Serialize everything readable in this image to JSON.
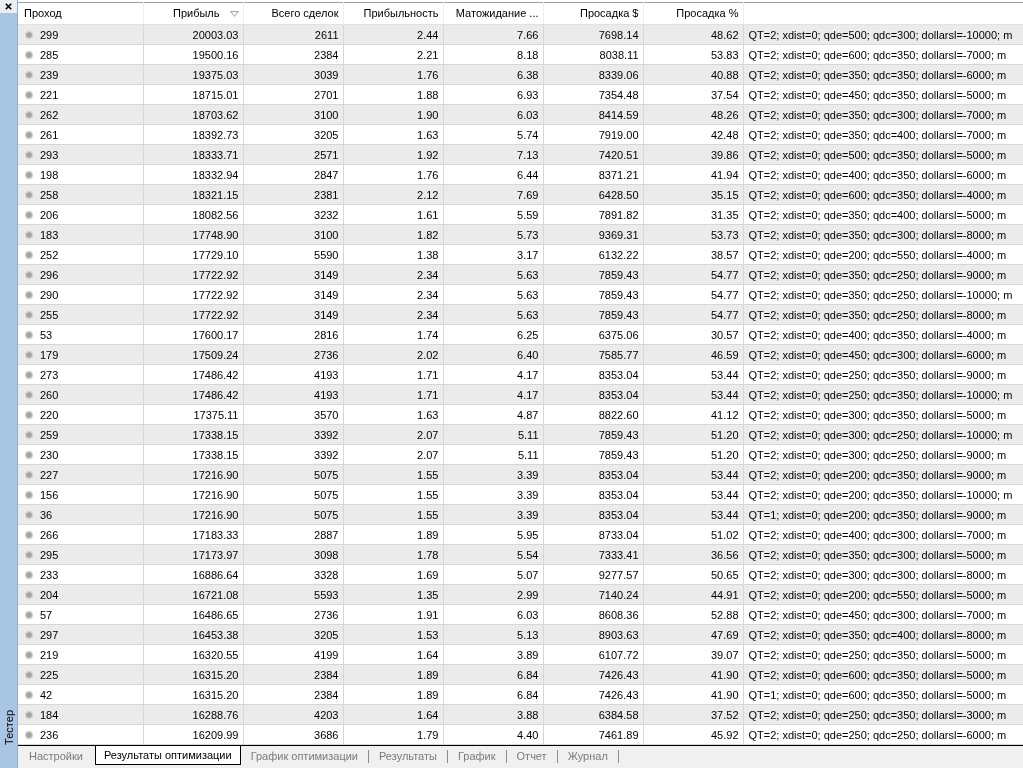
{
  "side_panel": {
    "title": "Тестер"
  },
  "table": {
    "columns": [
      {
        "label": "Проход",
        "sorted": false
      },
      {
        "label": "Прибыль",
        "sorted": true
      },
      {
        "label": "Всего сделок",
        "sorted": false
      },
      {
        "label": "Прибыльность",
        "sorted": false
      },
      {
        "label": "Матожидание ...",
        "sorted": false
      },
      {
        "label": "Просадка $",
        "sorted": false
      },
      {
        "label": "Просадка %",
        "sorted": false
      }
    ],
    "rows": [
      {
        "cells": [
          "299",
          "20003.03",
          "2611",
          "2.44",
          "7.66",
          "7698.14",
          "48.62",
          "QT=2; xdist=0; qde=500; qdc=300; dollarsl=-10000; m"
        ]
      },
      {
        "cells": [
          "285",
          "19500.16",
          "2384",
          "2.21",
          "8.18",
          "8038.11",
          "53.83",
          "QT=2; xdist=0; qde=600; qdc=350; dollarsl=-7000; m"
        ]
      },
      {
        "cells": [
          "239",
          "19375.03",
          "3039",
          "1.76",
          "6.38",
          "8339.06",
          "40.88",
          "QT=2; xdist=0; qde=350; qdc=350; dollarsl=-6000; m"
        ]
      },
      {
        "cells": [
          "221",
          "18715.01",
          "2701",
          "1.88",
          "6.93",
          "7354.48",
          "37.54",
          "QT=2; xdist=0; qde=450; qdc=350; dollarsl=-5000; m"
        ]
      },
      {
        "cells": [
          "262",
          "18703.62",
          "3100",
          "1.90",
          "6.03",
          "8414.59",
          "48.26",
          "QT=2; xdist=0; qde=350; qdc=300; dollarsl=-7000; m"
        ]
      },
      {
        "cells": [
          "261",
          "18392.73",
          "3205",
          "1.63",
          "5.74",
          "7919.00",
          "42.48",
          "QT=2; xdist=0; qde=350; qdc=400; dollarsl=-7000; m"
        ]
      },
      {
        "cells": [
          "293",
          "18333.71",
          "2571",
          "1.92",
          "7.13",
          "7420.51",
          "39.86",
          "QT=2; xdist=0; qde=500; qdc=350; dollarsl=-5000; m"
        ]
      },
      {
        "cells": [
          "198",
          "18332.94",
          "2847",
          "1.76",
          "6.44",
          "8371.21",
          "41.94",
          "QT=2; xdist=0; qde=400; qdc=350; dollarsl=-6000; m"
        ]
      },
      {
        "cells": [
          "258",
          "18321.15",
          "2381",
          "2.12",
          "7.69",
          "6428.50",
          "35.15",
          "QT=2; xdist=0; qde=600; qdc=350; dollarsl=-4000; m"
        ]
      },
      {
        "cells": [
          "206",
          "18082.56",
          "3232",
          "1.61",
          "5.59",
          "7891.82",
          "31.35",
          "QT=2; xdist=0; qde=350; qdc=400; dollarsl=-5000; m"
        ]
      },
      {
        "cells": [
          "183",
          "17748.90",
          "3100",
          "1.82",
          "5.73",
          "9369.31",
          "53.73",
          "QT=2; xdist=0; qde=350; qdc=300; dollarsl=-8000; m"
        ]
      },
      {
        "cells": [
          "252",
          "17729.10",
          "5590",
          "1.38",
          "3.17",
          "6132.22",
          "38.57",
          "QT=2; xdist=0; qde=200; qdc=550; dollarsl=-4000; m"
        ]
      },
      {
        "cells": [
          "296",
          "17722.92",
          "3149",
          "2.34",
          "5.63",
          "7859.43",
          "54.77",
          "QT=2; xdist=0; qde=350; qdc=250; dollarsl=-9000; m"
        ]
      },
      {
        "cells": [
          "290",
          "17722.92",
          "3149",
          "2.34",
          "5.63",
          "7859.43",
          "54.77",
          "QT=2; xdist=0; qde=350; qdc=250; dollarsl=-10000; m"
        ]
      },
      {
        "cells": [
          "255",
          "17722.92",
          "3149",
          "2.34",
          "5.63",
          "7859.43",
          "54.77",
          "QT=2; xdist=0; qde=350; qdc=250; dollarsl=-8000; m"
        ]
      },
      {
        "cells": [
          "53",
          "17600.17",
          "2816",
          "1.74",
          "6.25",
          "6375.06",
          "30.57",
          "QT=2; xdist=0; qde=400; qdc=350; dollarsl=-4000; m"
        ]
      },
      {
        "cells": [
          "179",
          "17509.24",
          "2736",
          "2.02",
          "6.40",
          "7585.77",
          "46.59",
          "QT=2; xdist=0; qde=450; qdc=300; dollarsl=-6000; m"
        ]
      },
      {
        "cells": [
          "273",
          "17486.42",
          "4193",
          "1.71",
          "4.17",
          "8353.04",
          "53.44",
          "QT=2; xdist=0; qde=250; qdc=350; dollarsl=-9000; m"
        ]
      },
      {
        "cells": [
          "260",
          "17486.42",
          "4193",
          "1.71",
          "4.17",
          "8353.04",
          "53.44",
          "QT=2; xdist=0; qde=250; qdc=350; dollarsl=-10000; m"
        ]
      },
      {
        "cells": [
          "220",
          "17375.11",
          "3570",
          "1.63",
          "4.87",
          "8822.60",
          "41.12",
          "QT=2; xdist=0; qde=300; qdc=350; dollarsl=-5000; m"
        ]
      },
      {
        "cells": [
          "259",
          "17338.15",
          "3392",
          "2.07",
          "5.11",
          "7859.43",
          "51.20",
          "QT=2; xdist=0; qde=300; qdc=250; dollarsl=-10000; m"
        ]
      },
      {
        "cells": [
          "230",
          "17338.15",
          "3392",
          "2.07",
          "5.11",
          "7859.43",
          "51.20",
          "QT=2; xdist=0; qde=300; qdc=250; dollarsl=-9000; m"
        ]
      },
      {
        "cells": [
          "227",
          "17216.90",
          "5075",
          "1.55",
          "3.39",
          "8353.04",
          "53.44",
          "QT=2; xdist=0; qde=200; qdc=350; dollarsl=-9000; m"
        ]
      },
      {
        "cells": [
          "156",
          "17216.90",
          "5075",
          "1.55",
          "3.39",
          "8353.04",
          "53.44",
          "QT=2; xdist=0; qde=200; qdc=350; dollarsl=-10000; m"
        ]
      },
      {
        "cells": [
          "36",
          "17216.90",
          "5075",
          "1.55",
          "3.39",
          "8353.04",
          "53.44",
          "QT=1; xdist=0; qde=200; qdc=350; dollarsl=-9000; m"
        ]
      },
      {
        "cells": [
          "266",
          "17183.33",
          "2887",
          "1.89",
          "5.95",
          "8733.04",
          "51.02",
          "QT=2; xdist=0; qde=400; qdc=300; dollarsl=-7000; m"
        ]
      },
      {
        "cells": [
          "295",
          "17173.97",
          "3098",
          "1.78",
          "5.54",
          "7333.41",
          "36.56",
          "QT=2; xdist=0; qde=350; qdc=300; dollarsl=-5000; m"
        ]
      },
      {
        "cells": [
          "233",
          "16886.64",
          "3328",
          "1.69",
          "5.07",
          "9277.57",
          "50.65",
          "QT=2; xdist=0; qde=300; qdc=300; dollarsl=-8000; m"
        ]
      },
      {
        "cells": [
          "204",
          "16721.08",
          "5593",
          "1.35",
          "2.99",
          "7140.24",
          "44.91",
          "QT=2; xdist=0; qde=200; qdc=550; dollarsl=-5000; m"
        ]
      },
      {
        "cells": [
          "57",
          "16486.65",
          "2736",
          "1.91",
          "6.03",
          "8608.36",
          "52.88",
          "QT=2; xdist=0; qde=450; qdc=300; dollarsl=-7000; m"
        ]
      },
      {
        "cells": [
          "297",
          "16453.38",
          "3205",
          "1.53",
          "5.13",
          "8903.63",
          "47.69",
          "QT=2; xdist=0; qde=350; qdc=400; dollarsl=-8000; m"
        ]
      },
      {
        "cells": [
          "219",
          "16320.55",
          "4199",
          "1.64",
          "3.89",
          "6107.72",
          "39.07",
          "QT=2; xdist=0; qde=250; qdc=350; dollarsl=-5000; m"
        ]
      },
      {
        "cells": [
          "225",
          "16315.20",
          "2384",
          "1.89",
          "6.84",
          "7426.43",
          "41.90",
          "QT=2; xdist=0; qde=600; qdc=350; dollarsl=-5000; m"
        ]
      },
      {
        "cells": [
          "42",
          "16315.20",
          "2384",
          "1.89",
          "6.84",
          "7426.43",
          "41.90",
          "QT=1; xdist=0; qde=600; qdc=350; dollarsl=-5000; m"
        ]
      },
      {
        "cells": [
          "184",
          "16288.76",
          "4203",
          "1.64",
          "3.88",
          "6384.58",
          "37.52",
          "QT=2; xdist=0; qde=250; qdc=350; dollarsl=-3000; m"
        ]
      },
      {
        "cells": [
          "236",
          "16209.99",
          "3686",
          "1.79",
          "4.40",
          "7461.89",
          "45.92",
          "QT=2; xdist=0; qde=250; qdc=250; dollarsl=-6000; m"
        ]
      }
    ]
  },
  "tabs": [
    {
      "label": "Настройки",
      "selected": false
    },
    {
      "label": "Результаты оптимизации",
      "selected": true
    },
    {
      "label": "График оптимизации",
      "selected": false
    },
    {
      "label": "Результаты",
      "selected": false
    },
    {
      "label": "График",
      "selected": false
    },
    {
      "label": "Отчет",
      "selected": false
    },
    {
      "label": "Журнал",
      "selected": false
    }
  ]
}
